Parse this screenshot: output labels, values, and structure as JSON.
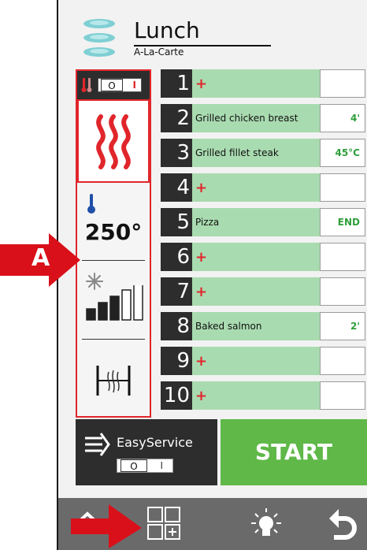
{
  "header": {
    "title": "Lunch",
    "subtitle": "A-La-Carte"
  },
  "left_panel": {
    "toggle": {
      "off": "O",
      "on": "I"
    },
    "temperature": "250°",
    "fan_level": 4,
    "fan_max": 5
  },
  "marker": {
    "label": "A"
  },
  "rows": [
    {
      "num": "1",
      "name": "+",
      "value": ""
    },
    {
      "num": "2",
      "name": "Grilled chicken breast",
      "value": "4'"
    },
    {
      "num": "3",
      "name": "Grilled fillet steak",
      "value": "45°C"
    },
    {
      "num": "4",
      "name": "+",
      "value": ""
    },
    {
      "num": "5",
      "name": "Pizza",
      "value": "END"
    },
    {
      "num": "6",
      "name": "+",
      "value": ""
    },
    {
      "num": "7",
      "name": "+",
      "value": ""
    },
    {
      "num": "8",
      "name": "Baked salmon",
      "value": "2'"
    },
    {
      "num": "9",
      "name": "+",
      "value": ""
    },
    {
      "num": "10",
      "name": "+",
      "value": ""
    }
  ],
  "easy_service": {
    "label": "EasyService",
    "toggle": {
      "off": "O",
      "on": "I"
    }
  },
  "start_label": "START",
  "colors": {
    "accent_red": "#e0262b",
    "green": "#5fb848",
    "row_green": "#a9dbb0",
    "dark": "#2d2d2d"
  },
  "icons": [
    "plates-icon",
    "thermo-icon",
    "heat-icon",
    "temperature-icon",
    "fan-icon",
    "fan-level-icon",
    "rack-icon",
    "easyservice-icon",
    "home-icon",
    "grid-add-icon",
    "light-icon",
    "back-icon"
  ]
}
